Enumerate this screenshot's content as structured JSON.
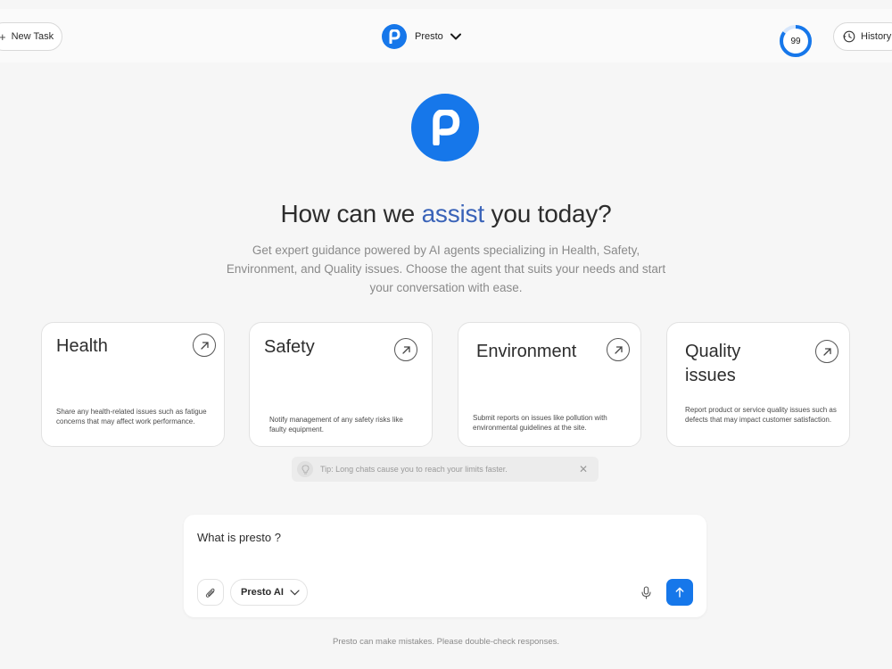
{
  "header": {
    "new_task_label": "New Task",
    "brand_name": "Presto",
    "credits": "99",
    "credits_fraction": 0.85,
    "history_label": "History"
  },
  "hero": {
    "headline_pre": "How can we",
    "headline_accent": "assist",
    "headline_post": "you today?",
    "subtitle": "Get expert guidance powered by AI agents specializing in Health, Safety, Environment, and Quality issues. Choose the agent that suits your needs and start your conversation with ease."
  },
  "cards": [
    {
      "title": "Health",
      "description": "Share any health-related issues such as fatigue concerns that may affect work performance."
    },
    {
      "title": "Safety",
      "description": "Notify management of any safety risks like faulty equipment."
    },
    {
      "title": "Environment",
      "description": "Submit reports on issues like pollution with environmental guidelines at the site."
    },
    {
      "title": "Quality issues",
      "description": "Report product or service quality issues such as defects that may impact customer satisfaction."
    }
  ],
  "tip": {
    "text": "Tip: Long chats cause you to reach your limits faster."
  },
  "composer": {
    "query": "What is presto ?",
    "model": "Presto AI"
  },
  "footer": {
    "disclaimer": "Presto can make mistakes. Please double-check responses."
  },
  "colors": {
    "brand_blue": "#1677ea",
    "accent_text": "#3a63b8"
  }
}
